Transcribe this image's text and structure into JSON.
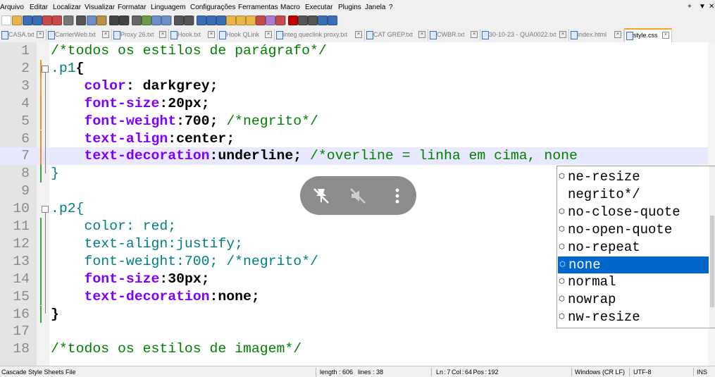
{
  "menu": {
    "items": [
      "Arquivo",
      "Editar",
      "Localizar",
      "Visualizar",
      "Formatar",
      "Linguagem",
      "Configurações",
      "Ferramentas",
      "Macro",
      "Executar",
      "Plugins",
      "Janela",
      "?"
    ],
    "right": [
      "+",
      "▼",
      "✕"
    ]
  },
  "tabs": [
    {
      "label": "CASA.txt"
    },
    {
      "label": "CarrierWeb.txt"
    },
    {
      "label": "Proxy 26.txt"
    },
    {
      "label": "Hook.txt"
    },
    {
      "label": "Hook QLink"
    },
    {
      "label": "integ queclink proxy.txt"
    },
    {
      "label": "CAT GREP.txt"
    },
    {
      "label": "CWBR.txt"
    },
    {
      "label": "30-10-23 - QUA0022.txt"
    },
    {
      "label": "index.html"
    },
    {
      "label": "style.css"
    }
  ],
  "active_tab": "style.css",
  "editor": {
    "line_numbers": [
      "1",
      "2",
      "3",
      "4",
      "5",
      "6",
      "7",
      "8",
      "9",
      "10",
      "11",
      "12",
      "13",
      "14",
      "15",
      "16",
      "17",
      "18"
    ],
    "current_line": 7,
    "lines": [
      [
        {
          "t": "/*todos os estilos de parágrafo*/",
          "c": "cmt"
        }
      ],
      [
        {
          "t": ".p1",
          "c": "sel"
        },
        {
          "t": "{",
          "c": "brace"
        }
      ],
      [
        {
          "t": "    color",
          "c": "prop"
        },
        {
          "t": ": ",
          "c": "punct"
        },
        {
          "t": "darkgrey",
          "c": "val"
        },
        {
          "t": ";",
          "c": "punct"
        }
      ],
      [
        {
          "t": "    font-size",
          "c": "prop"
        },
        {
          "t": ":",
          "c": "punct"
        },
        {
          "t": "20px",
          "c": "val"
        },
        {
          "t": ";",
          "c": "punct"
        }
      ],
      [
        {
          "t": "    font-weight",
          "c": "prop"
        },
        {
          "t": ":",
          "c": "punct"
        },
        {
          "t": "700",
          "c": "val"
        },
        {
          "t": "; ",
          "c": "punct"
        },
        {
          "t": "/*negrito*/",
          "c": "cmt"
        }
      ],
      [
        {
          "t": "    text-align",
          "c": "prop"
        },
        {
          "t": ":",
          "c": "punct"
        },
        {
          "t": "center",
          "c": "val"
        },
        {
          "t": ";",
          "c": "punct"
        }
      ],
      [
        {
          "t": "    text-decoration",
          "c": "prop"
        },
        {
          "t": ":",
          "c": "punct"
        },
        {
          "t": "underline",
          "c": "val"
        },
        {
          "t": "; ",
          "c": "punct"
        },
        {
          "t": "/*overline = linha em cima, none",
          "c": "cmt"
        }
      ],
      [
        {
          "t": "}",
          "c": "sel"
        }
      ],
      [],
      [
        {
          "t": ".p2{",
          "c": "sel"
        }
      ],
      [
        {
          "t": "    color: red;",
          "c": "sel"
        }
      ],
      [
        {
          "t": "    text-align:justify;",
          "c": "sel"
        }
      ],
      [
        {
          "t": "    font-weight:700; /*negrito*/",
          "c": "sel"
        }
      ],
      [
        {
          "t": "    font-size",
          "c": "prop"
        },
        {
          "t": ":",
          "c": "punct"
        },
        {
          "t": "30px",
          "c": "val"
        },
        {
          "t": ";",
          "c": "punct"
        }
      ],
      [
        {
          "t": "    text-decoration",
          "c": "prop"
        },
        {
          "t": ":",
          "c": "punct"
        },
        {
          "t": "none",
          "c": "val"
        },
        {
          "t": ";",
          "c": "punct"
        }
      ],
      [
        {
          "t": "}",
          "c": "brace"
        }
      ],
      [],
      [
        {
          "t": "/*todos os estilos de imagem*/",
          "c": "cmt"
        }
      ]
    ]
  },
  "autocomplete": {
    "items": [
      {
        "label": "ne-resize",
        "icon": true
      },
      {
        "label": "negrito*/",
        "icon": false
      },
      {
        "label": "no-close-quote",
        "icon": true
      },
      {
        "label": "no-open-quote",
        "icon": true
      },
      {
        "label": "no-repeat",
        "icon": true
      },
      {
        "label": "none",
        "icon": true,
        "selected": true
      },
      {
        "label": "normal",
        "icon": true
      },
      {
        "label": "nowrap",
        "icon": true
      },
      {
        "label": "nw-resize",
        "icon": true
      }
    ]
  },
  "overlay": {
    "icons": [
      "pin-off-icon",
      "volume-off-icon",
      "more-vertical-icon"
    ]
  },
  "status": {
    "file_type": "Cascade Style Sheets File",
    "length": "length : 606",
    "lines": "lines : 38",
    "position": "Ln : 7    Col : 64    Pos : 192",
    "eol": "Windows (CR LF)",
    "encoding": "UTF-8",
    "mode": "INS"
  },
  "colors": {
    "comment": "#008000",
    "selector": "#008080",
    "property": "#8000ff",
    "current_line": "#e8e8ff",
    "ac_selected": "#0066cc",
    "tab_accent": "#f5a623"
  }
}
